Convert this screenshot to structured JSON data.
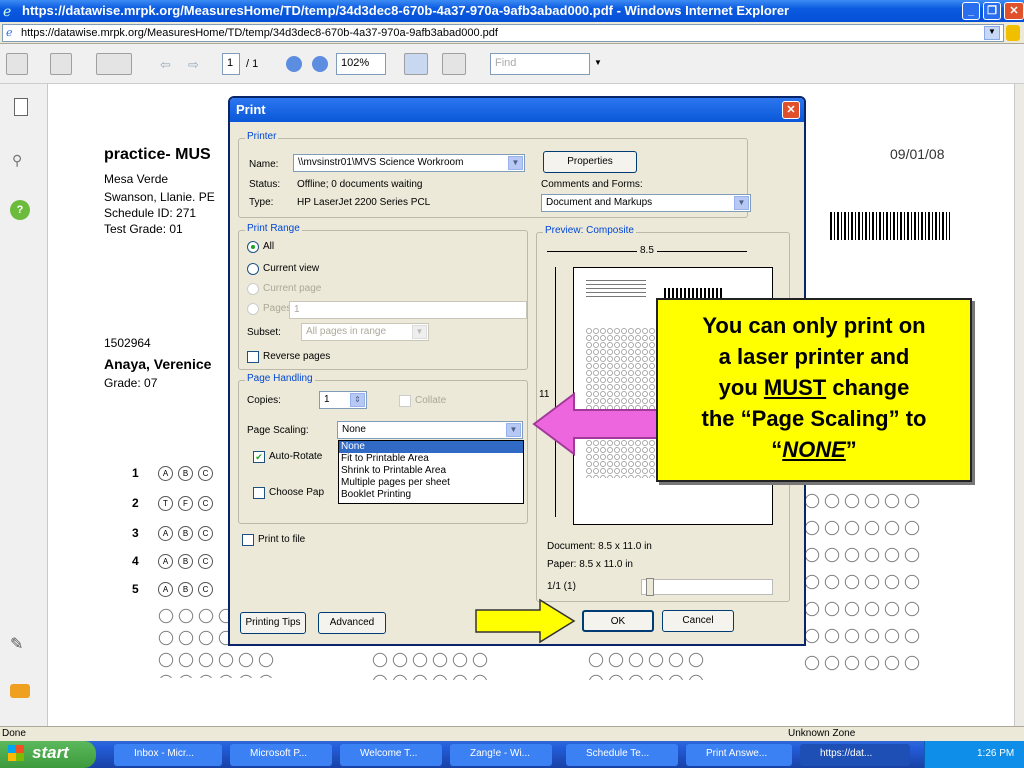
{
  "window": {
    "title": "https://datawise.mrpk.org/MeasuresHome/TD/temp/34d3dec8-670b-4a37-970a-9afb3abad000.pdf - Windows Internet Explorer",
    "address": "https://datawise.mrpk.org/MeasuresHome/TD/temp/34d3dec8-670b-4a37-970a-9afb3abad000.pdf"
  },
  "toolbar": {
    "page_current": "1",
    "page_total": "/ 1",
    "zoom": "102%",
    "find_placeholder": "Find"
  },
  "document": {
    "title": "practice- MUS",
    "date": "09/01/08",
    "school": "Mesa Verde",
    "teacher": "Swanson, Llanie. PE",
    "schedule": "Schedule ID: 271",
    "grade": "Test Grade:  01",
    "student_id": "1502964",
    "student_name": "Anaya, Verenice",
    "student_grade": "Grade: 07",
    "question_numbers": [
      "1",
      "2",
      "3",
      "4",
      "5"
    ],
    "q1_choices": [
      "A",
      "B",
      "C"
    ],
    "q2_choices": [
      "T",
      "F",
      "C"
    ]
  },
  "dialog": {
    "title": "Print",
    "printer_group": "Printer",
    "name_label": "Name:",
    "name_value": "\\\\mvsinstr01\\MVS Science Workroom",
    "status_label": "Status:",
    "status_value": "Offline; 0 documents waiting",
    "type_label": "Type:",
    "type_value": "HP LaserJet 2200 Series PCL",
    "properties": "Properties",
    "comments_label": "Comments and Forms:",
    "comments_value": "Document and Markups",
    "range_group": "Print Range",
    "all": "All",
    "current_view": "Current view",
    "current_page": "Current page",
    "pages": "Pages",
    "pages_value": "1",
    "subset_label": "Subset:",
    "subset_value": "All pages in range",
    "reverse": "Reverse pages",
    "handling_group": "Page Handling",
    "copies_label": "Copies:",
    "copies_value": "1",
    "collate": "Collate",
    "scaling_label": "Page Scaling:",
    "scaling_value": "None",
    "scaling_options": [
      "None",
      "Fit to Printable Area",
      "Shrink to Printable Area",
      "Multiple pages per sheet",
      "Booklet Printing"
    ],
    "auto_rotate": "Auto-Rotate",
    "choose_paper": "Choose Pap",
    "print_to_file": "Print to file",
    "preview_group": "Preview: Composite",
    "preview_width": "8.5",
    "preview_height": "11",
    "doc_size": "Document: 8.5 x 11.0 in",
    "paper_size": "Paper: 8.5 x 11.0 in",
    "page_count": "1/1 (1)",
    "printing_tips": "Printing Tips",
    "advanced": "Advanced",
    "ok": "OK",
    "cancel": "Cancel"
  },
  "callout": {
    "line1": "You can only print on",
    "line2": "a laser printer and",
    "line3_pre": "you ",
    "line3_must": "MUST",
    "line3_post": " change",
    "line4": "the “Page Scaling” to",
    "line5_open": "“",
    "line5_none": "NONE",
    "line5_close": "”"
  },
  "statusbar": {
    "left": "Done",
    "zone": "Unknown Zone"
  },
  "taskbar": {
    "start": "start",
    "tasks": [
      "Inbox - Micr...",
      "Microsoft P...",
      "Welcome T...",
      "Zang!e - Wi...",
      "Schedule Te...",
      "Print Answe...",
      "https://dat..."
    ],
    "time": "1:26 PM"
  },
  "colors": {
    "callout_bg": "#ffff00",
    "arrow_pink": "#ee66dd",
    "arrow_yellow": "#ffff00",
    "titlebar": "#0a58d8"
  }
}
